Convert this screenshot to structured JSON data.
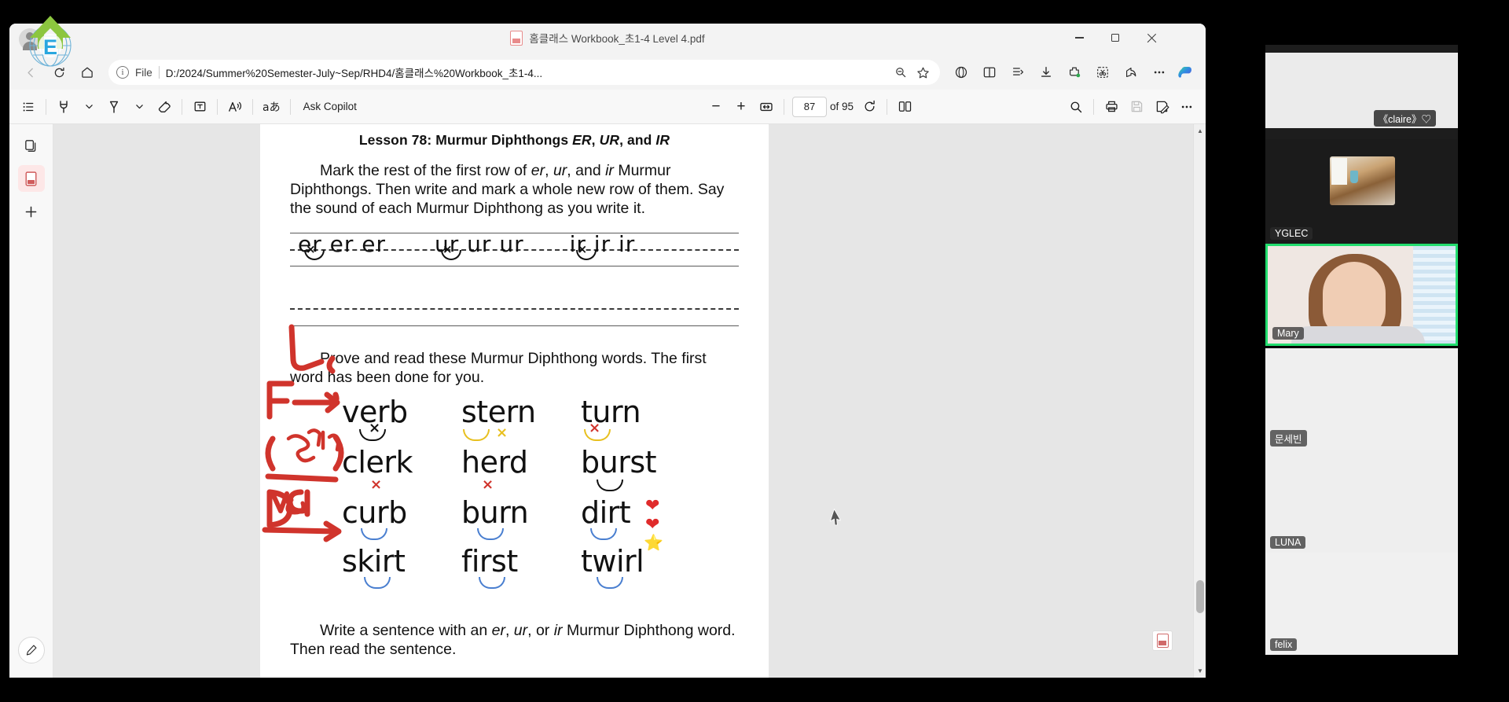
{
  "browser": {
    "tab_title": "홈클래스 Workbook_초1-4 Level 4.pdf",
    "window_controls": {
      "minimize": "Minimize",
      "maximize": "Restore",
      "close": "Close"
    },
    "url_scheme_label": "File",
    "url": "D:/2024/Summer%20Semester-July~Sep/RHD4/홈클래스%20Workbook_초1-4...",
    "nav_icons": [
      "back-arrow",
      "refresh",
      "home"
    ],
    "url_trailing_icons": [
      "zoom-out-magnifier",
      "favorite-star"
    ],
    "toolbar_icons": [
      "browser-essentials",
      "split-screen",
      "collections",
      "downloads",
      "extensions",
      "screenshot",
      "share",
      "settings-more",
      "copilot"
    ]
  },
  "pdf_toolbar": {
    "items": [
      {
        "name": "toc",
        "label": ""
      },
      {
        "name": "highlighter",
        "label": ""
      },
      {
        "name": "highlighter-chevron",
        "label": ""
      },
      {
        "name": "pen",
        "label": ""
      },
      {
        "name": "pen-chevron",
        "label": ""
      },
      {
        "name": "eraser",
        "label": ""
      },
      {
        "name": "add-text",
        "label": ""
      },
      {
        "name": "read-aloud",
        "label": ""
      },
      {
        "name": "translate",
        "label": ""
      }
    ],
    "ask_copilot_label": "Ask Copilot",
    "zoom_out": "−",
    "zoom_in": "+",
    "fit_page": "fit-to-width",
    "page_number": "87",
    "page_total": "of 95",
    "rotate": "rotate-icon",
    "page_view": "page-view-icon",
    "search": "search-icon",
    "print": "print-icon",
    "save": "save-icon",
    "save_as": "save-as-icon",
    "more": "more-options-icon"
  },
  "left_rail": {
    "items": [
      "copy-tool",
      "pdf-document",
      "add-new"
    ],
    "edit_button": "pen-edit-icon"
  },
  "document": {
    "lesson_title_prefix": "Lesson 78: Murmur Diphthongs ",
    "lesson_title_er": "ER",
    "lesson_title_comma1": ", ",
    "lesson_title_ur": "UR",
    "lesson_title_and": ", and ",
    "lesson_title_ir": "IR",
    "instruction_1": "Mark the rest of the first row of er, ur, and ir Murmur Diphthongs. Then write and mark a whole new row of them. Say the sound of each Murmur Diphthong as you write it.",
    "practice_row": {
      "er": "er er er",
      "ur": "ur ur ur",
      "ir": "ir ir ir"
    },
    "instruction_2": "Prove and read these Murmur Diphthong words. The first word has been done for you.",
    "words": [
      {
        "text": "verb",
        "mark": "smile",
        "mark_color": "black"
      },
      {
        "text": "stern",
        "mark": "smile",
        "mark_color": "yellow"
      },
      {
        "text": "turn",
        "mark": "x",
        "mark_color": "red"
      },
      {
        "text": "clerk",
        "mark": "x",
        "mark_color": "red"
      },
      {
        "text": "herd",
        "mark": "x",
        "mark_color": "red"
      },
      {
        "text": "burst",
        "mark": "smile",
        "mark_color": "black"
      },
      {
        "text": "curb",
        "mark": "smile",
        "mark_color": "blue"
      },
      {
        "text": "burn",
        "mark": "smile",
        "mark_color": "blue"
      },
      {
        "text": "dirt",
        "mark": "smile",
        "mark_color": "blue"
      },
      {
        "text": "skirt",
        "mark": "smile",
        "mark_color": "blue"
      },
      {
        "text": "first",
        "mark": "smile",
        "mark_color": "blue"
      },
      {
        "text": "twirl",
        "mark": "smile",
        "mark_color": "blue"
      }
    ],
    "stickers": [
      "❤",
      "❤",
      "⭐"
    ],
    "instruction_3": "Write a sentence with an er, ur, or ir Murmur Diphthong word. Then read the sentence.",
    "ink_annotations": [
      "L",
      "F",
      "Claire",
      "D",
      "G"
    ]
  },
  "video_panel": {
    "participants": [
      {
        "name": "《claire》♡",
        "active": false
      },
      {
        "name": "YGLEC",
        "active": false
      },
      {
        "name": "Mary",
        "active": true
      },
      {
        "name": "문세빈",
        "active": false
      },
      {
        "name": "LUNA",
        "active": false
      },
      {
        "name": "felix",
        "active": false
      }
    ],
    "active_border_color": "#22dd6e"
  },
  "colors": {
    "ink_red": "#d0342c",
    "mark_blue": "#4a7fd0",
    "mark_yellow": "#e8c020",
    "active_green": "#22dd6e"
  }
}
